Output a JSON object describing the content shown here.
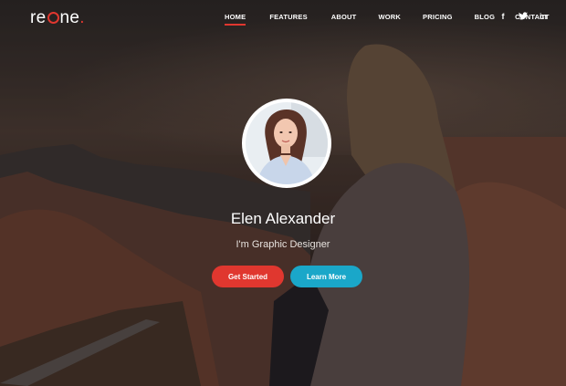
{
  "brand": {
    "prefix": "re",
    "suffix": "ne",
    "dot": "."
  },
  "nav": {
    "items": [
      "HOME",
      "FEATURES",
      "ABOUT",
      "WORK",
      "PRICING",
      "BLOG",
      "CONTACT"
    ],
    "active": "HOME"
  },
  "social": {
    "facebook": "f",
    "twitter": "t",
    "linkedin": "in"
  },
  "hero": {
    "name": "Elen Alexander",
    "role": "I'm Graphic Designer",
    "primary_button": "Get Started",
    "secondary_button": "Learn More"
  },
  "colors": {
    "accent_red": "#e0372f",
    "accent_blue": "#1aa7c9"
  }
}
